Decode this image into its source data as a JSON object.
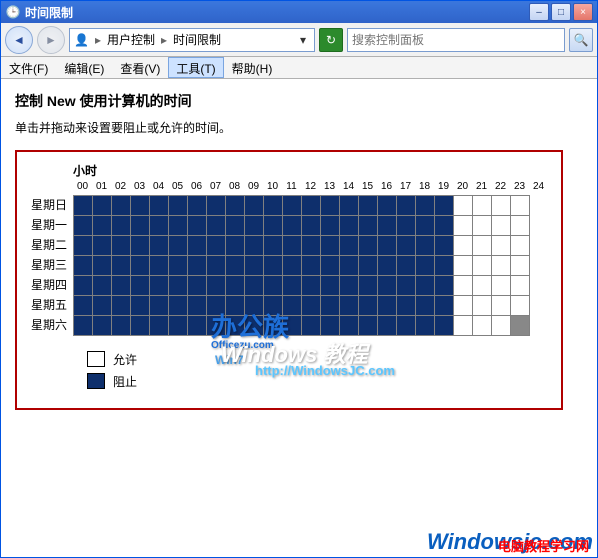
{
  "window": {
    "title": "时间限制"
  },
  "winbtns": {
    "min": "–",
    "max": "□",
    "close": "×"
  },
  "nav": {
    "back": "◄",
    "forward": "►"
  },
  "breadcrumb": {
    "icon": "👤",
    "seg1": "用户控制",
    "seg2": "时间限制",
    "dropdown": "▾"
  },
  "refresh": "↻",
  "search": {
    "placeholder": "搜索控制面板",
    "icon": "🔍"
  },
  "menu": {
    "file": "文件(F)",
    "edit": "编辑(E)",
    "view": "查看(V)",
    "tools": "工具(T)",
    "help": "帮助(H)"
  },
  "heading": {
    "prefix": "控制 ",
    "user": "New",
    "suffix": " 使用计算机的时间"
  },
  "subtext": "单击并拖动来设置要阻止或允许的时间。",
  "hours_label": "小时",
  "hours": [
    "00",
    "01",
    "02",
    "03",
    "04",
    "05",
    "06",
    "07",
    "08",
    "09",
    "10",
    "11",
    "12",
    "13",
    "14",
    "15",
    "16",
    "17",
    "18",
    "19",
    "20",
    "21",
    "22",
    "23",
    "24"
  ],
  "days": [
    "星期日",
    "星期一",
    "星期二",
    "星期三",
    "星期四",
    "星期五",
    "星期六"
  ],
  "grid": {
    "rows": 7,
    "cols": 24,
    "blocked_cols_start": 0,
    "blocked_cols_end": 19,
    "selected_cell": {
      "row": 6,
      "col": 23
    }
  },
  "legend": {
    "allow": "允许",
    "block": "阻止"
  },
  "watermark": {
    "brand": "办公族",
    "brand_sub": "Officezu.com",
    "win7": "Win7",
    "title": "Windows 教程",
    "url": "http://WindowsJC.com"
  },
  "footer": {
    "logo": "Windowsjc.com",
    "red": "电脑教程学习网"
  }
}
